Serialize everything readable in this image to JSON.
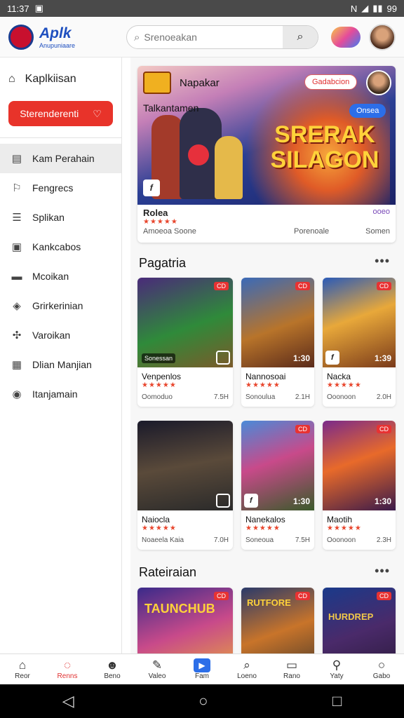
{
  "status": {
    "time": "11:37",
    "battery": "99"
  },
  "header": {
    "brand": "Aplk",
    "brand_sub": "Anupuniaare",
    "search_placeholder": "Srenoeakan"
  },
  "sidebar": {
    "home_label": "Kaplkiisan",
    "button_label": "Sterenderenti",
    "items": [
      {
        "label": "Kam Perahain",
        "icon": "file-icon"
      },
      {
        "label": "Fengrecs",
        "icon": "bookmark-icon"
      },
      {
        "label": "Splikan",
        "icon": "list-icon"
      },
      {
        "label": "Kankcabos",
        "icon": "tablet-icon"
      },
      {
        "label": "Mcoikan",
        "icon": "folder-icon"
      },
      {
        "label": "Grirkerinian",
        "icon": "compass-icon"
      },
      {
        "label": "Varoikan",
        "icon": "puzzle-icon"
      },
      {
        "label": "Dlian Manjian",
        "icon": "calendar-icon"
      },
      {
        "label": "Itanjamain",
        "icon": "circle-icon"
      }
    ]
  },
  "hero": {
    "title": "Napakar",
    "subtitle": "Talkantamen",
    "badge": "Gadabcion",
    "pill": "Onsea",
    "big_text_1": "SRERAK",
    "big_text_2": "SILAGON",
    "name": "Rolea",
    "right_meta": "ooeo",
    "stars": "★★★★★",
    "meta_left": "Amoeoa Soone",
    "meta_mid": "Porenoale",
    "meta_right": "Somen"
  },
  "section1": {
    "title": "Pagatria",
    "cards": [
      {
        "name": "Venpenlos",
        "stars": "★★★★★",
        "left": "Oomoduo",
        "right": "7.5H",
        "badge": "Sonessan",
        "num": "",
        "tag": "CD"
      },
      {
        "name": "Nannosoai",
        "stars": "★★★★★",
        "left": "Sonoulua",
        "right": "2.1H",
        "badge": "",
        "num": "1:30",
        "tag": "CD"
      },
      {
        "name": "Nacka",
        "stars": "★★★★★",
        "left": "Ooonoon",
        "right": "2.0H",
        "badge": "",
        "num": "1:39",
        "tag": "CD"
      },
      {
        "name": "Naiocla",
        "stars": "★★★★★",
        "left": "Noaeela Kaia",
        "right": "7.0H",
        "badge": "",
        "num": "",
        "tag": ""
      },
      {
        "name": "Nanekalos",
        "stars": "★★★★★",
        "left": "Soneoua",
        "right": "7.5H",
        "badge": "",
        "num": "1:30",
        "tag": "CD"
      },
      {
        "name": "Maotih",
        "stars": "★★★★★",
        "left": "Ooonoon",
        "right": "2.3H",
        "badge": "",
        "num": "1:30",
        "tag": "CD"
      }
    ]
  },
  "section2": {
    "title": "Rateiraian",
    "cards": [
      {
        "title_art": "TAUNCHUB",
        "tag": "CD"
      },
      {
        "title_art": "RUTFORE",
        "tag": "CD"
      },
      {
        "title_art": "HURDREP",
        "tag": "CD"
      }
    ]
  },
  "bottomnav": [
    {
      "label": "Reor",
      "icon": "home-icon"
    },
    {
      "label": "Renns",
      "icon": "chat-icon"
    },
    {
      "label": "Beno",
      "icon": "user-icon"
    },
    {
      "label": "Valeo",
      "icon": "pen-icon"
    },
    {
      "label": "Fam",
      "icon": "play-icon"
    },
    {
      "label": "Loeno",
      "icon": "search-icon"
    },
    {
      "label": "Rano",
      "icon": "tv-icon"
    },
    {
      "label": "Yaty",
      "icon": "pin-icon"
    },
    {
      "label": "Gabo",
      "icon": "circle-icon"
    }
  ],
  "colors": {
    "accent_red": "#e8332a",
    "brand_blue": "#1e4fbf",
    "accent_blue": "#2c6ee8"
  }
}
